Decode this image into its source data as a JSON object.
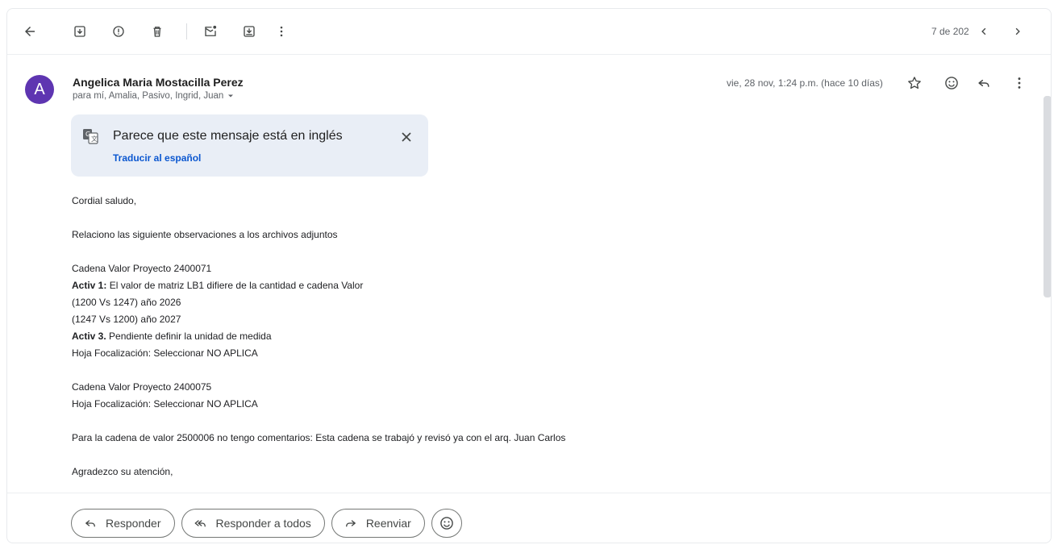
{
  "toolbar": {
    "pager": "7 de 202",
    "icons": [
      "back-arrow-icon",
      "archive-icon",
      "report-spam-icon",
      "delete-icon",
      "mark-unread-icon",
      "move-to-icon",
      "more-vert-icon",
      "prev-icon",
      "next-icon"
    ]
  },
  "message": {
    "avatar_letter": "A",
    "avatar_color": "#5e35b1",
    "sender": "Angelica Maria Mostacilla Perez",
    "recipients": "para mí, Amalia, Pasivo, Ingrid, Juan",
    "date": "vie, 28 nov, 1:24 p.m. (hace 10 días)"
  },
  "translate": {
    "title": "Parece que este mensaje está en inglés",
    "link": "Traducir al español"
  },
  "body": {
    "l1": "Cordial saludo,",
    "l2": "Relaciono las siguiente observaciones a los archivos adjuntos",
    "l3": "Cadena Valor Proyecto 2400071",
    "l4_bold": "Activ 1:",
    "l4_rest": " El valor de matriz LB1 difiere de la cantidad e cadena Valor",
    "l5": "(1200 Vs 1247) año 2026",
    "l6": "(1247 Vs 1200) año 2027",
    "l7_bold": "Activ 3.",
    "l7_rest": " Pendiente definir la unidad de medida",
    "l8": "Hoja Focalización: Seleccionar NO APLICA",
    "l9": "Cadena Valor Proyecto 2400075",
    "l10": "Hoja Focalización: Seleccionar NO APLICA",
    "l11": "Para la cadena de valor 2500006 no tengo comentarios: Esta cadena se trabajó y revisó ya con el arq. Juan Carlos",
    "l12": "Agradezco su atención,"
  },
  "actions": {
    "reply": "Responder",
    "reply_all": "Responder a todos",
    "forward": "Reenviar"
  }
}
